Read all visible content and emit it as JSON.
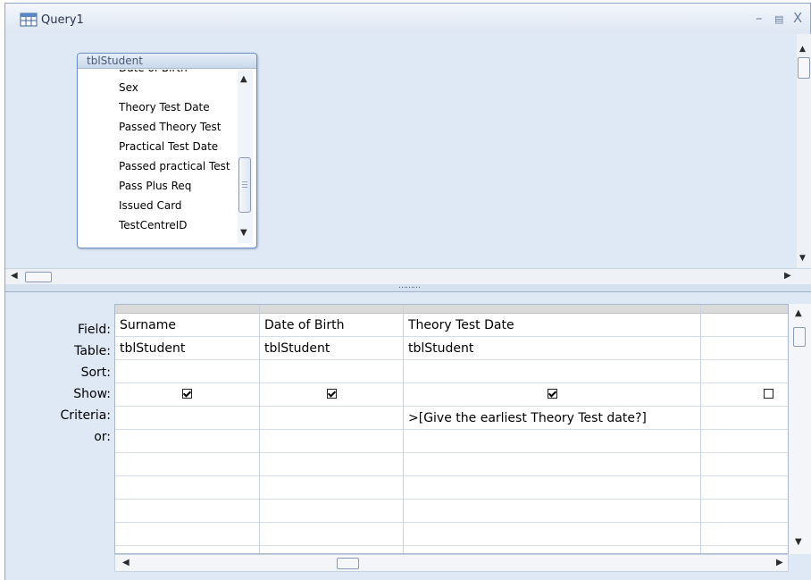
{
  "window": {
    "title": "Query1",
    "icon": "query-icon"
  },
  "table_box": {
    "title": "tblStudent",
    "fields": [
      "Date of Birth",
      "Sex",
      "Theory Test Date",
      "Passed Theory Test",
      "Practical Test Date",
      "Passed practical Test",
      "Pass Plus Req",
      "Issued Card",
      "TestCentreID"
    ]
  },
  "grid": {
    "row_labels": [
      "Field:",
      "Table:",
      "Sort:",
      "Show:",
      "Criteria:",
      "or:"
    ],
    "columns": [
      {
        "field": "Surname",
        "table": "tblStudent",
        "sort": "",
        "show": true,
        "criteria": "",
        "or": ""
      },
      {
        "field": "Date of Birth",
        "table": "tblStudent",
        "sort": "",
        "show": true,
        "criteria": "",
        "or": ""
      },
      {
        "field": "Theory Test Date",
        "table": "tblStudent",
        "sort": "",
        "show": true,
        "criteria": ">[Give the earliest Theory Test date?]",
        "or": ""
      },
      {
        "field": "",
        "table": "",
        "sort": "",
        "show": false,
        "criteria": "",
        "or": ""
      }
    ]
  },
  "colors": {
    "window_bg": "#dfe8f5",
    "border": "#8ba7c9"
  }
}
